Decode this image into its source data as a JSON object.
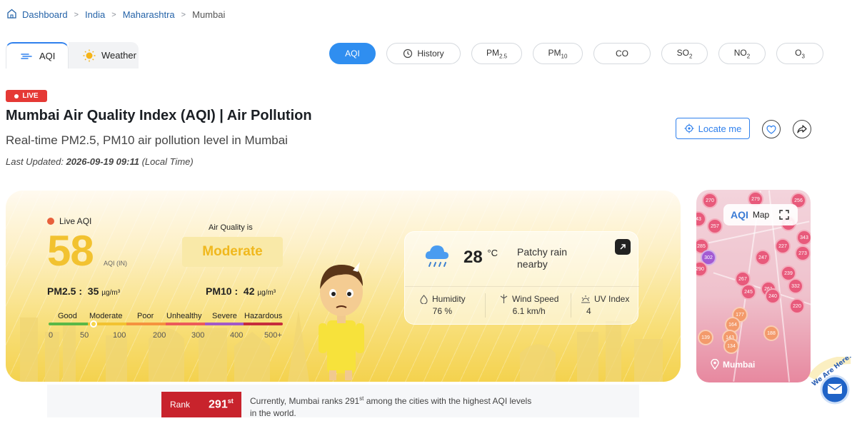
{
  "breadcrumb": {
    "items": [
      "Dashboard",
      "India",
      "Maharashtra"
    ],
    "current": "Mumbai"
  },
  "main_tabs": [
    {
      "label": "AQI",
      "icon": "wind-icon",
      "active": true
    },
    {
      "label": "Weather",
      "icon": "sun-icon",
      "active": false
    }
  ],
  "pollutant_tabs": [
    {
      "label": "AQI",
      "active": true
    },
    {
      "label": "History",
      "active": false
    },
    {
      "label": "PM2.5",
      "active": false
    },
    {
      "label": "PM10",
      "active": false
    },
    {
      "label": "CO",
      "active": false
    },
    {
      "label": "SO2",
      "active": false
    },
    {
      "label": "NO2",
      "active": false
    },
    {
      "label": "O3",
      "active": false
    }
  ],
  "live_badge": "LIVE",
  "header": {
    "title": "Mumbai Air Quality Index (AQI) | Air Pollution",
    "subtitle": "Real-time PM2.5, PM10 air pollution level in Mumbai",
    "updated_prefix": "Last Updated: ",
    "updated_value": "2026-09-19 09:11",
    "updated_suffix": " (Local Time)"
  },
  "actions": {
    "locate_label": "Locate me",
    "favorite_icon": "heart-icon",
    "share_icon": "share-icon"
  },
  "aqi": {
    "live_label": "Live AQI",
    "value": "58",
    "unit": "AQI (IN)",
    "status_prefix": "Air Quality is",
    "status": "Moderate",
    "pm25_label": "PM2.5 :",
    "pm25_value": "35",
    "pm10_label": "PM10 :",
    "pm10_value": "42",
    "pm_unit": "µg/m³",
    "scale_labels": [
      "Good",
      "Moderate",
      "Poor",
      "Unhealthy",
      "Severe",
      "Hazardous"
    ],
    "scale_numbers": [
      "0",
      "50",
      "100",
      "200",
      "300",
      "400",
      "500+"
    ],
    "scale_colors": [
      "#59b847",
      "#f2c230",
      "#f5923e",
      "#ec5a5a",
      "#a259c7",
      "#c62c3c"
    ]
  },
  "weather": {
    "temperature": "28",
    "temp_unit": "°C",
    "condition": "Patchy rain nearby",
    "humidity_label": "Humidity",
    "humidity_value": "76 %",
    "wind_label": "Wind Speed",
    "wind_value": "6.1 km/h",
    "uv_label": "UV Index",
    "uv_value": "4"
  },
  "map": {
    "logo": "AQI",
    "label": "Map",
    "place": "Mumbai",
    "bubbles": [
      "270",
      "279",
      "256",
      "257",
      "43",
      "285",
      "302",
      "247",
      "227",
      "290",
      "267",
      "239",
      "332",
      "245",
      "261",
      "240",
      "220",
      "177",
      "164",
      "139",
      "143",
      "134",
      "188",
      "273",
      "343",
      "368"
    ]
  },
  "rank": {
    "label": "Rank",
    "value": "291",
    "suffix": "st",
    "text_prefix": "Currently, Mumbai ranks 291",
    "text_sup": "st",
    "text_suffix": " among the cities with the highest AQI levels in the world."
  },
  "chat_widget": {
    "label": "We Are Here!"
  }
}
